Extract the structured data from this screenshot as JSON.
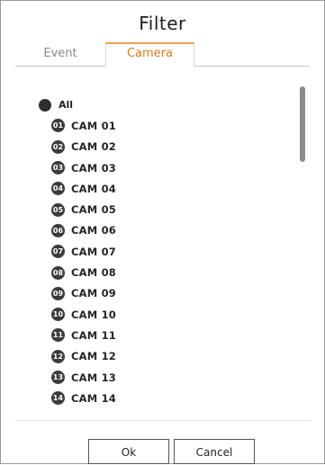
{
  "dialog": {
    "title": "Filter"
  },
  "tabs": [
    {
      "label": "Event",
      "active": false
    },
    {
      "label": "Camera",
      "active": true
    }
  ],
  "list": {
    "all_label": "All",
    "cameras": [
      {
        "badge": "01",
        "label": "CAM 01"
      },
      {
        "badge": "02",
        "label": "CAM 02"
      },
      {
        "badge": "03",
        "label": "CAM 03"
      },
      {
        "badge": "04",
        "label": "CAM 04"
      },
      {
        "badge": "05",
        "label": "CAM 05"
      },
      {
        "badge": "06",
        "label": "CAM 06"
      },
      {
        "badge": "07",
        "label": "CAM 07"
      },
      {
        "badge": "08",
        "label": "CAM 08"
      },
      {
        "badge": "09",
        "label": "CAM 09"
      },
      {
        "badge": "10",
        "label": "CAM 10"
      },
      {
        "badge": "11",
        "label": "CAM 11"
      },
      {
        "badge": "12",
        "label": "CAM 12"
      },
      {
        "badge": "13",
        "label": "CAM 13"
      },
      {
        "badge": "14",
        "label": "CAM 14"
      }
    ]
  },
  "buttons": {
    "ok_label": "Ok",
    "cancel_label": "Cancel"
  },
  "colors": {
    "active_tab_text": "#e0791e",
    "active_tab_border": "#f0a050",
    "badge_bg": "#3b3b3b",
    "scrollbar_thumb": "#8c8c8c"
  }
}
